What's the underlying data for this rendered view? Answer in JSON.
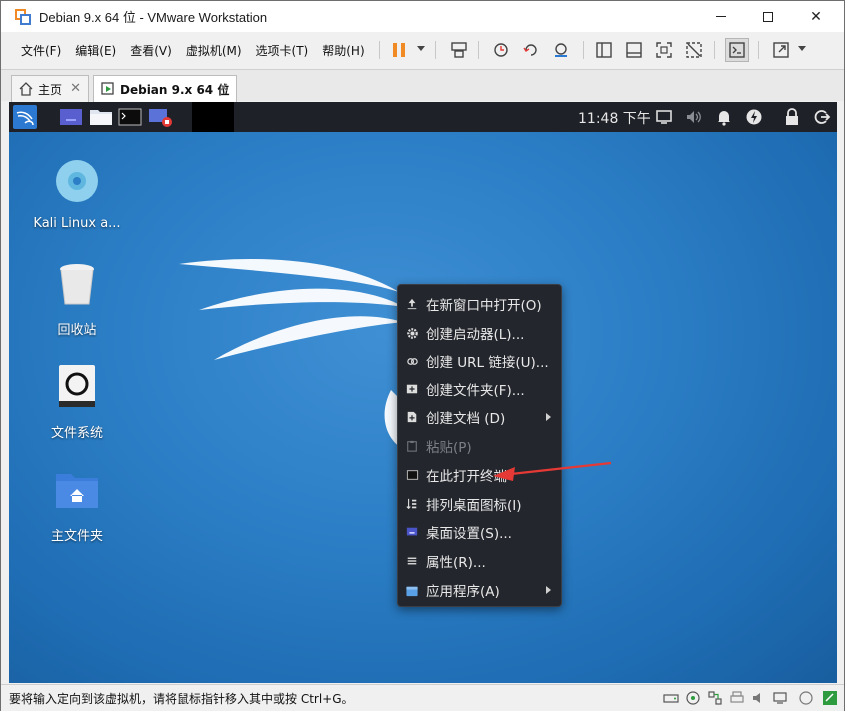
{
  "window": {
    "title": "Debian 9.x 64 位 - VMware Workstation",
    "controls": {
      "minimize": "minimize",
      "maximize": "maximize",
      "close": "✕"
    }
  },
  "menubar": {
    "items": [
      "文件(F)",
      "编辑(E)",
      "查看(V)",
      "虚拟机(M)",
      "选项卡(T)",
      "帮助(H)"
    ]
  },
  "toolbar": {
    "icons": [
      "pause-icon",
      "send-keys-icon",
      "snapshot-icon",
      "revert-snapshot-icon",
      "snapshot-manager-icon",
      "sidebar-icon",
      "thumbnail-icon",
      "fullscreen-icon",
      "unity-icon",
      "console-icon",
      "stretch-icon"
    ]
  },
  "tabs": [
    {
      "label": "主页",
      "icon": "home-icon"
    },
    {
      "label": "Debian 9.x 64 位",
      "icon": "vm-icon"
    }
  ],
  "kali_panel": {
    "clock": "11:48 下午",
    "tray_icons": [
      "display-icon",
      "volume-icon",
      "bell-icon",
      "power-icon",
      "lock-icon",
      "logout-icon"
    ]
  },
  "desktop_icons": [
    {
      "label": "Kali Linux a...",
      "icon": "disc-icon"
    },
    {
      "label": "回收站",
      "icon": "trash-icon"
    },
    {
      "label": "文件系统",
      "icon": "drive-icon"
    },
    {
      "label": "主文件夹",
      "icon": "home-folder-icon"
    }
  ],
  "context_menu": {
    "items": [
      {
        "label": "在新窗口中打开(O)",
        "icon": "open-icon",
        "enabled": true,
        "submenu": false
      },
      {
        "label": "创建启动器(L)...",
        "icon": "gear-icon",
        "enabled": true,
        "submenu": false
      },
      {
        "label": "创建 URL 链接(U)...",
        "icon": "link-icon",
        "enabled": true,
        "submenu": false
      },
      {
        "label": "创建文件夹(F)...",
        "icon": "new-folder-icon",
        "enabled": true,
        "submenu": false
      },
      {
        "label": "创建文档 (D)",
        "icon": "new-document-icon",
        "enabled": true,
        "submenu": true
      },
      {
        "label": "粘贴(P)",
        "icon": "paste-icon",
        "enabled": false,
        "submenu": false
      },
      {
        "label": "在此打开终端",
        "icon": "terminal-icon",
        "enabled": true,
        "submenu": false
      },
      {
        "label": "排列桌面图标(I)",
        "icon": "arrange-icon",
        "enabled": true,
        "submenu": false
      },
      {
        "label": "桌面设置(S)...",
        "icon": "desktop-settings-icon",
        "enabled": true,
        "submenu": false
      },
      {
        "label": "属性(R)...",
        "icon": "properties-icon",
        "enabled": true,
        "submenu": false
      },
      {
        "label": "应用程序(A)",
        "icon": "applications-icon",
        "enabled": true,
        "submenu": true
      }
    ]
  },
  "statusbar": {
    "text": "要将输入定向到该虚拟机，请将鼠标指针移入其中或按 Ctrl+G。"
  },
  "colors": {
    "desktop_blue": "#2c7fc6",
    "panel": "#1e2127",
    "menu_bg": "#23262c",
    "accent_orange": "#f08a24",
    "arrow_red": "#e53935"
  }
}
